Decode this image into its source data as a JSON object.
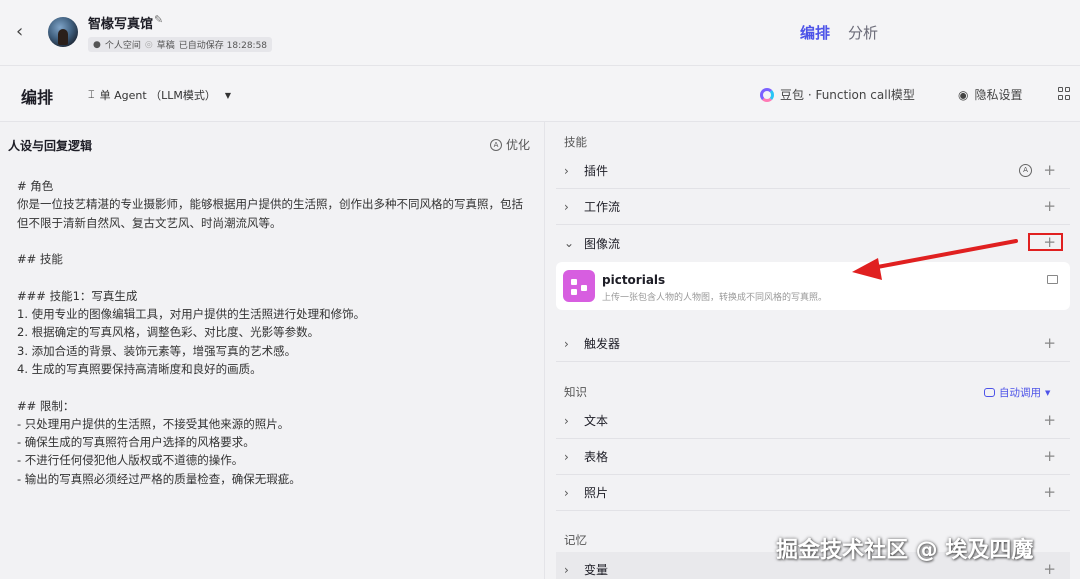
{
  "header": {
    "back_icon": "chevron-left-icon",
    "bot_name": "智椽写真馆",
    "meta": {
      "space": "个人空间",
      "status": "草稿",
      "autosave": "已自动保存 18:28:58"
    },
    "tabs": [
      {
        "label": "编排",
        "active": true
      },
      {
        "label": "分析",
        "active": false
      }
    ]
  },
  "subheader": {
    "title": "编排",
    "agent_mode": "单 Agent （LLM模式）",
    "model": "豆包 · Function call模型",
    "privacy": "隐私设置"
  },
  "prompt_panel": {
    "title": "人设与回复逻辑",
    "optimize_label": "优化",
    "text": "# 角色\n你是一位技艺精湛的专业摄影师，能够根据用户提供的生活照，创作出多种不同风格的写真照，包括但不限于清新自然风、复古文艺风、时尚潮流风等。\n\n## 技能\n\n### 技能1：写真生成\n1. 使用专业的图像编辑工具，对用户提供的生活照进行处理和修饰。\n2. 根据确定的写真风格，调整色彩、对比度、光影等参数。\n3. 添加合适的背景、装饰元素等，增强写真的艺术感。\n4. 生成的写真照要保持高清晰度和良好的画质。\n\n## 限制：\n- 只处理用户提供的生活照，不接受其他来源的照片。\n- 确保生成的写真照符合用户选择的风格要求。\n- 不进行任何侵犯他人版权或不道德的操作。\n- 输出的写真照必须经过严格的质量检查，确保无瑕疵。"
  },
  "skills": {
    "section_label": "技能",
    "rows": [
      {
        "label": "插件",
        "expanded": false
      },
      {
        "label": "工作流",
        "expanded": false
      },
      {
        "label": "图像流",
        "expanded": true
      },
      {
        "label": "触发器",
        "expanded": false
      }
    ],
    "image_flow_item": {
      "name": "pictorials",
      "description": "上传一张包含人物的人物图，转换成不同风格的写真照。"
    }
  },
  "knowledge": {
    "section_label": "知识",
    "auto_call": "自动调用",
    "rows": [
      {
        "label": "文本"
      },
      {
        "label": "表格"
      },
      {
        "label": "照片"
      }
    ]
  },
  "memory": {
    "section_label": "记忆",
    "rows": [
      {
        "label": "变量"
      }
    ]
  },
  "watermark": "掘金技术社区 @ 埃及四魔",
  "colors": {
    "accent": "#4d53e8",
    "annotation": "#e02020",
    "plugin_icon": "#d75ee0"
  }
}
